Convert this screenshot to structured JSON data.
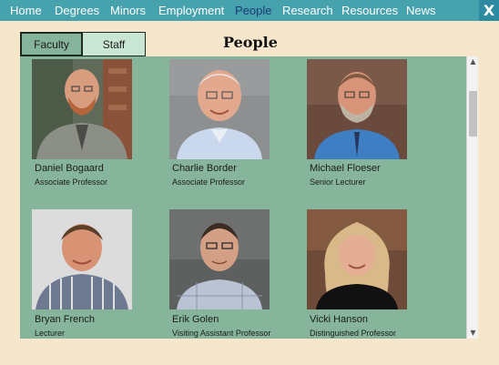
{
  "nav": {
    "items": [
      "Home",
      "Degrees",
      "Minors",
      "Employment",
      "People",
      "Research",
      "Resources",
      "News"
    ],
    "active": "People",
    "close_label": "X"
  },
  "tabs": {
    "faculty": "Faculty",
    "staff": "Staff"
  },
  "page_title": "People",
  "people": [
    {
      "name": "Daniel Bogaard",
      "role": "Associate Professor"
    },
    {
      "name": "Charlie Border",
      "role": "Associate Professor"
    },
    {
      "name": "Michael Floeser",
      "role": "Senior Lecturer"
    },
    {
      "name": "Bryan French",
      "role": "Lecturer"
    },
    {
      "name": "Erik Golen",
      "role": "Visiting Assistant Professor"
    },
    {
      "name": "Vicki Hanson",
      "role": "Distinguished Professor"
    }
  ],
  "colors": {
    "nav_bg": "#46a2ad",
    "nav_active": "#1c3b77",
    "page_bg": "#f6e6cc",
    "panel_bg": "#87b59c",
    "tab_active": "#86b39c",
    "tab_inactive": "#c9e6d5"
  }
}
